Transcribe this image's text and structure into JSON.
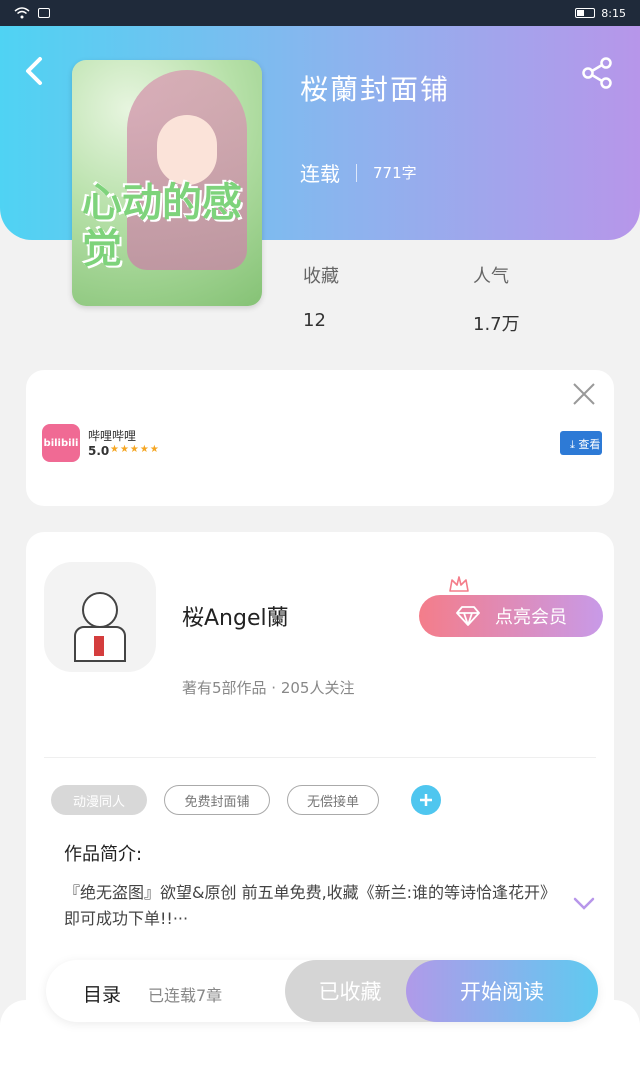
{
  "status_bar": {
    "time": "8:15"
  },
  "book": {
    "title": "桜蘭封面铺",
    "status": "连载",
    "words": "771字",
    "cover_text": "心动的感觉",
    "stats": [
      {
        "label": "收藏",
        "value": "12"
      },
      {
        "label": "人气",
        "value": "1.7万"
      }
    ]
  },
  "ad": {
    "app_name": "哔哩哔哩",
    "logo_text": "bilibili",
    "rating": "5.0",
    "stars": "★★★★★",
    "download_label": "⤓ 查看"
  },
  "author": {
    "name": "桜Angel蘭",
    "subtitle": "著有5部作品 · 205人关注",
    "vip_label": "点亮会员"
  },
  "tags": [
    "动漫同人",
    "免费封面铺",
    "无偿接单"
  ],
  "intro": {
    "label": "作品简介:",
    "text": "『绝无盗图』欲望&原创  前五单免费,收藏《新兰:谁的等诗恰逢花开》即可成功下单!!···"
  },
  "bottom_bar": {
    "catalog_label": "目录",
    "chapters_label": "已连载7章",
    "favorited_label": "已收藏",
    "read_label": "开始阅读"
  },
  "colors": {
    "header_start": "#4fd3f3",
    "header_end": "#b796ea",
    "accent_pink": "#f47d8a",
    "accent_blue": "#4fc6ef"
  }
}
